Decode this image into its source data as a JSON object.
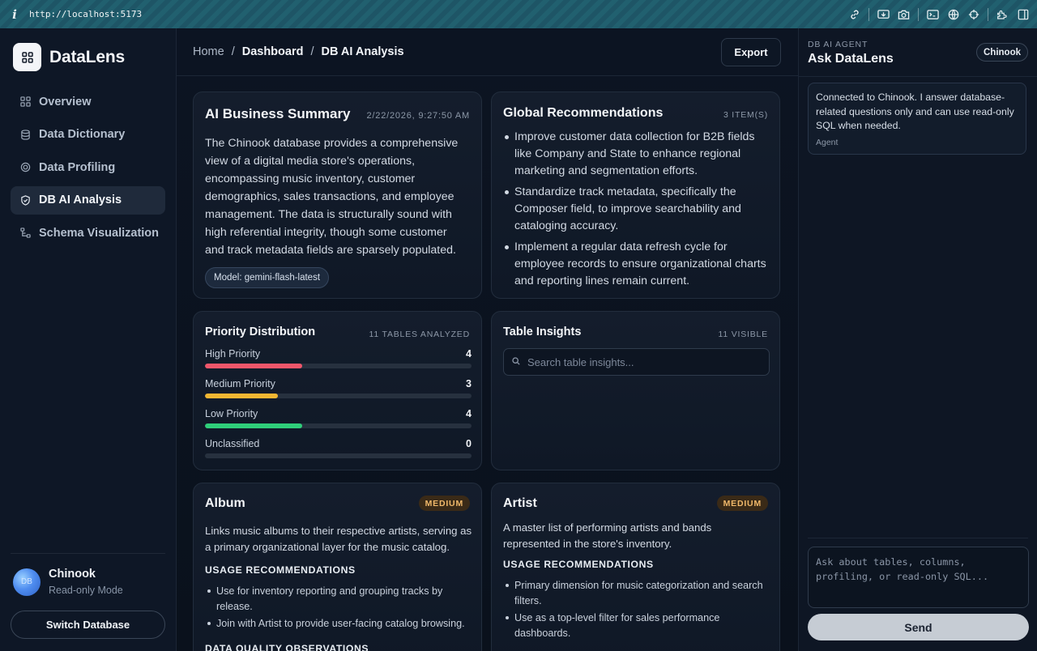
{
  "browser": {
    "info_glyph": "i",
    "url": "http://localhost:5173"
  },
  "sidebar": {
    "brand": "DataLens",
    "nav": [
      {
        "label": "Overview",
        "icon": "grid-icon"
      },
      {
        "label": "Data Dictionary",
        "icon": "database-icon"
      },
      {
        "label": "Data Profiling",
        "icon": "target-icon"
      },
      {
        "label": "DB AI Analysis",
        "icon": "shield-check-icon",
        "active": true
      },
      {
        "label": "Schema Visualization",
        "icon": "schema-icon"
      }
    ],
    "db_avatar_text": "DB",
    "db_name": "Chinook",
    "db_mode": "Read-only Mode",
    "switch_label": "Switch Database"
  },
  "header": {
    "crumbs": [
      "Home",
      "Dashboard",
      "DB AI Analysis"
    ],
    "separator": "/",
    "export_label": "Export"
  },
  "summary": {
    "title": "AI Business Summary",
    "timestamp": "2/22/2026, 9:27:50 AM",
    "text": "The Chinook database provides a comprehensive view of a digital media store's operations, encompassing music inventory, customer demographics, sales transactions, and employee management. The data is structurally sound with high referential integrity, though some customer and track metadata fields are sparsely populated.",
    "model_chip": "Model: gemini-flash-latest"
  },
  "recommendations": {
    "title": "Global Recommendations",
    "count_label": "3 ITEM(S)",
    "items": [
      "Improve customer data collection for B2B fields like Company and State to enhance regional marketing and segmentation efforts.",
      "Standardize track metadata, specifically the Composer field, to improve searchability and cataloging accuracy.",
      "Implement a regular data refresh cycle for employee records to ensure organizational charts and reporting lines remain current."
    ]
  },
  "priority": {
    "title": "Priority Distribution",
    "meta": "11 TABLES ANALYZED",
    "rows": [
      {
        "label": "High Priority",
        "count": "4",
        "fraction": 0.364,
        "color": "#f0566b"
      },
      {
        "label": "Medium Priority",
        "count": "3",
        "fraction": 0.273,
        "color": "#f2b632"
      },
      {
        "label": "Low Priority",
        "count": "4",
        "fraction": 0.364,
        "color": "#2fce7a"
      },
      {
        "label": "Unclassified",
        "count": "0",
        "fraction": 0,
        "color": "#8d98a8"
      }
    ]
  },
  "insights": {
    "title": "Table Insights",
    "meta": "11 VISIBLE",
    "search_placeholder": "Search table insights..."
  },
  "album": {
    "title": "Album",
    "badge": "MEDIUM",
    "description": "Links music albums to their respective artists, serving as a primary organizational layer for the music catalog.",
    "usage_heading": "USAGE RECOMMENDATIONS",
    "usage": [
      "Use for inventory reporting and grouping tracks by release.",
      "Join with Artist to provide user-facing catalog browsing."
    ],
    "quality_heading": "DATA QUALITY OBSERVATIONS"
  },
  "artist": {
    "title": "Artist",
    "badge": "MEDIUM",
    "description": "A master list of performing artists and bands represented in the store's inventory.",
    "usage_heading": "USAGE RECOMMENDATIONS",
    "usage": [
      "Primary dimension for music categorization and search filters.",
      "Use as a top-level filter for sales performance dashboards."
    ]
  },
  "agent": {
    "kicker": "DB AI AGENT",
    "title": "Ask DataLens",
    "db_chip": "Chinook",
    "message": "Connected to Chinook. I answer database-related questions only and can use read-only SQL when needed.",
    "message_author": "Agent",
    "input_placeholder": "Ask about tables, columns, profiling, or read-only SQL...",
    "send_label": "Send"
  }
}
